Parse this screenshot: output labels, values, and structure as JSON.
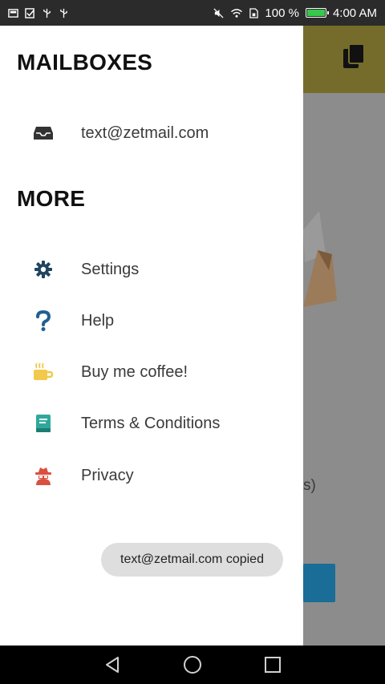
{
  "status_bar": {
    "battery_text": "100 %",
    "time": "4:00 AM",
    "battery_level": 1.0,
    "icons_left": [
      "image-notification-icon",
      "check-notification-icon",
      "usb-icon",
      "usb-debug-icon"
    ],
    "icons_right": [
      "mute-icon",
      "wifi-icon",
      "sim-icon",
      "battery-icon"
    ]
  },
  "background_app": {
    "toolbar_color": "#756c2c",
    "partial_text": "s)",
    "copy_icon": "copy-icon"
  },
  "drawer": {
    "mailboxes_title": "MAILBOXES",
    "mailboxes": [
      {
        "label": "text@zetmail.com",
        "icon": "inbox-icon"
      }
    ],
    "more_title": "MORE",
    "more_items": [
      {
        "label": "Settings",
        "icon": "gear-icon",
        "color": "#1f4560"
      },
      {
        "label": "Help",
        "icon": "question-icon",
        "color": "#1f5f93"
      },
      {
        "label": "Buy me coffee!",
        "icon": "coffee-icon",
        "color": "#f2c94c"
      },
      {
        "label": "Terms & Conditions",
        "icon": "book-icon",
        "color": "#2fa89c"
      },
      {
        "label": "Privacy",
        "icon": "spy-icon",
        "color": "#d9503f"
      }
    ]
  },
  "toast": {
    "message": "text@zetmail.com copied"
  },
  "nav_bar": {
    "icons": [
      "back-icon",
      "home-icon",
      "recents-icon"
    ]
  }
}
